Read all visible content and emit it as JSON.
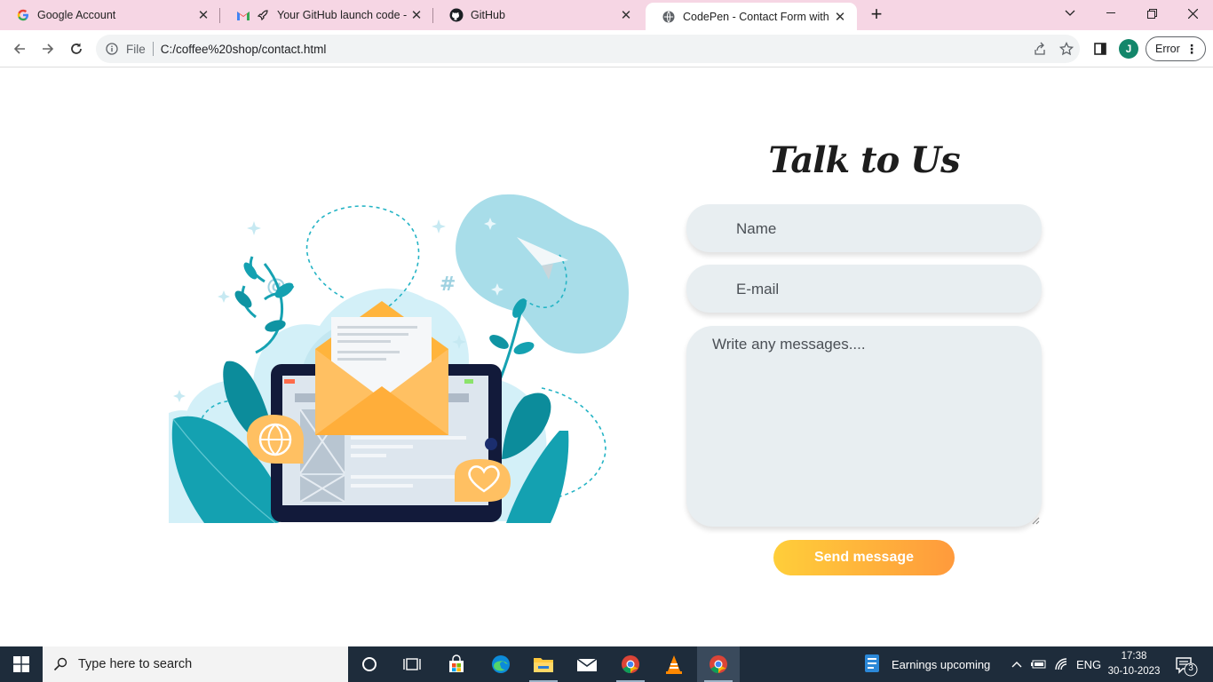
{
  "browser": {
    "tabs": [
      {
        "title": "Google Account",
        "icon": "google-icon",
        "active": false
      },
      {
        "title": "Your GitHub launch code - ja",
        "icon": "gmail-icon",
        "active": false
      },
      {
        "title": "GitHub",
        "icon": "github-icon",
        "active": false
      },
      {
        "title": "CodePen - Contact Form with S\\",
        "icon": "globe-icon",
        "active": true
      }
    ],
    "new_tab_label": "+",
    "address": {
      "scheme": "File",
      "url": "C:/coffee%20shop/contact.html"
    },
    "profile_initial": "J",
    "error_label": "Error"
  },
  "page": {
    "heading": "Talk to Us",
    "form": {
      "name_placeholder": "Name",
      "email_placeholder": "E-mail",
      "message_placeholder": "Write any messages....",
      "send_label": "Send message"
    },
    "colors": {
      "field_bg": "#e8eef1",
      "button_gradient_start": "#ffce3a",
      "button_gradient_end": "#ff9a3c",
      "illustration_teal": "#1aa3b4",
      "illustration_orange": "#ffb43c"
    }
  },
  "taskbar": {
    "search_placeholder": "Type here to search",
    "news_text": "Earnings upcoming",
    "language": "ENG",
    "time": "17:38",
    "date": "30-10-2023",
    "notification_count": "3",
    "apps": [
      "task-view-icon",
      "store-icon",
      "edge-icon",
      "file-explorer-icon",
      "mail-icon",
      "chrome-icon",
      "vlc-icon",
      "chrome-icon"
    ]
  }
}
